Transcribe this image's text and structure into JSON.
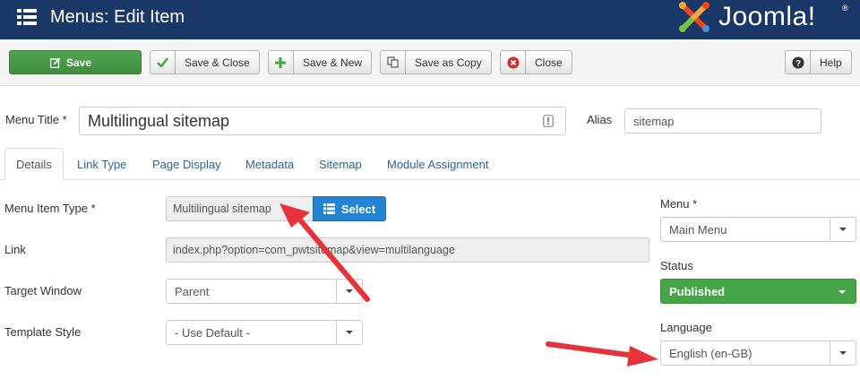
{
  "header": {
    "title": "Menus: Edit Item",
    "logo_text": "Joomla!",
    "logo_reg": "®"
  },
  "toolbar": {
    "save_label": "Save",
    "save_close_label": "Save & Close",
    "save_new_label": "Save & New",
    "save_copy_label": "Save as Copy",
    "close_label": "Close",
    "help_label": "Help"
  },
  "form": {
    "menu_title_label": "Menu Title *",
    "menu_title_value": "Multilingual sitemap",
    "alias_label": "Alias",
    "alias_value": "sitemap"
  },
  "tabs": [
    {
      "label": "Details"
    },
    {
      "label": "Link Type"
    },
    {
      "label": "Page Display"
    },
    {
      "label": "Metadata"
    },
    {
      "label": "Sitemap"
    },
    {
      "label": "Module Assignment"
    }
  ],
  "details": {
    "menu_item_type_label": "Menu Item Type *",
    "menu_item_type_value": "Multilingual sitemap",
    "select_label": "Select",
    "link_label": "Link",
    "link_value": "index.php?option=com_pwtsitemap&view=multilanguage",
    "target_window_label": "Target Window",
    "target_window_value": "Parent",
    "template_style_label": "Template Style",
    "template_style_value": "- Use Default -"
  },
  "sidebar": {
    "menu_label": "Menu *",
    "menu_value": "Main Menu",
    "status_label": "Status",
    "status_value": "Published",
    "language_label": "Language",
    "language_value": "English (en-GB)"
  },
  "colors": {
    "header_bg": "#1a3867",
    "save_green": "#46a546",
    "select_blue": "#2384d3",
    "annotation_red": "#e8323a"
  },
  "icons": {
    "header": "menu-list-icon",
    "save": "edit-icon",
    "save_close": "check-icon",
    "save_new": "plus-icon",
    "save_copy": "copy-icon",
    "close": "close-circle-icon",
    "help": "question-circle-icon",
    "select": "list-icon"
  }
}
